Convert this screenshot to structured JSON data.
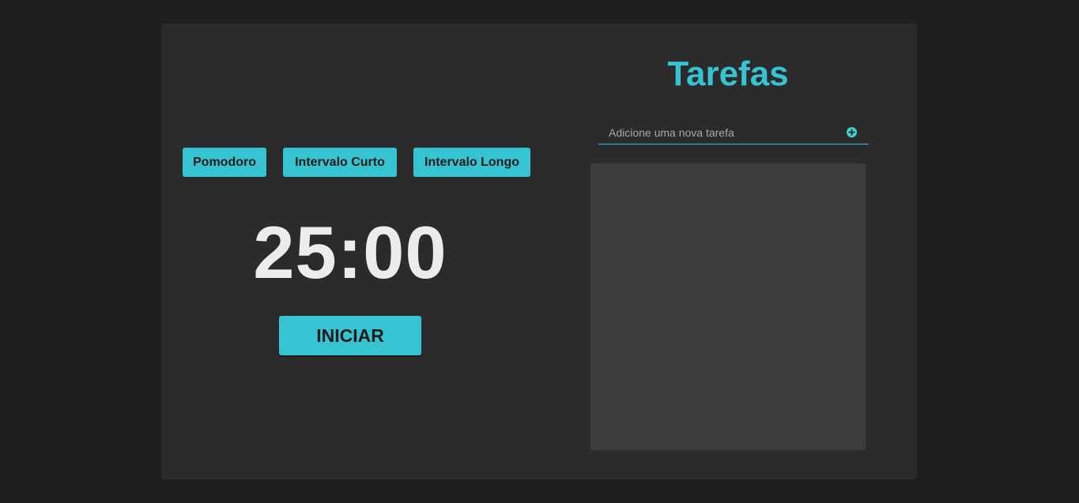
{
  "timer": {
    "modes": [
      {
        "label": "Pomodoro"
      },
      {
        "label": "Intervalo Curto"
      },
      {
        "label": "Intervalo Longo"
      }
    ],
    "display": "25:00",
    "start_label": "INICIAR"
  },
  "tasks": {
    "title": "Tarefas",
    "input_placeholder": "Adicione uma nova tarefa",
    "add_icon": "plus-circle-icon",
    "items": []
  },
  "colors": {
    "accent": "#37c4d2",
    "background": "#1f1f1f",
    "panel": "#2b2b2b",
    "task_list": "#3c3c3c",
    "timer_text": "#ececec"
  }
}
